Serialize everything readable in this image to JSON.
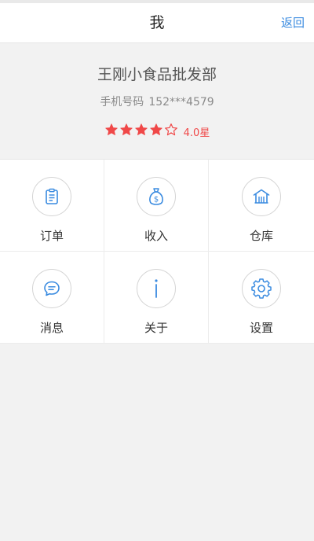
{
  "nav": {
    "title": "我",
    "back_label": "返回"
  },
  "profile": {
    "shop_name": "王刚小食品批发部",
    "phone_label": "手机号码",
    "phone_number": "152***4579",
    "rating": {
      "filled_stars": 4,
      "total_stars": 5,
      "text": "4.0星"
    }
  },
  "menu": [
    {
      "label": "订单",
      "icon": "clipboard-icon"
    },
    {
      "label": "收入",
      "icon": "money-bag-icon"
    },
    {
      "label": "仓库",
      "icon": "warehouse-icon"
    },
    {
      "label": "消息",
      "icon": "chat-bubble-icon"
    },
    {
      "label": "关于",
      "icon": "info-icon"
    },
    {
      "label": "设置",
      "icon": "gear-icon"
    }
  ],
  "colors": {
    "accent": "#3a8be0",
    "rating": "#f04848"
  }
}
